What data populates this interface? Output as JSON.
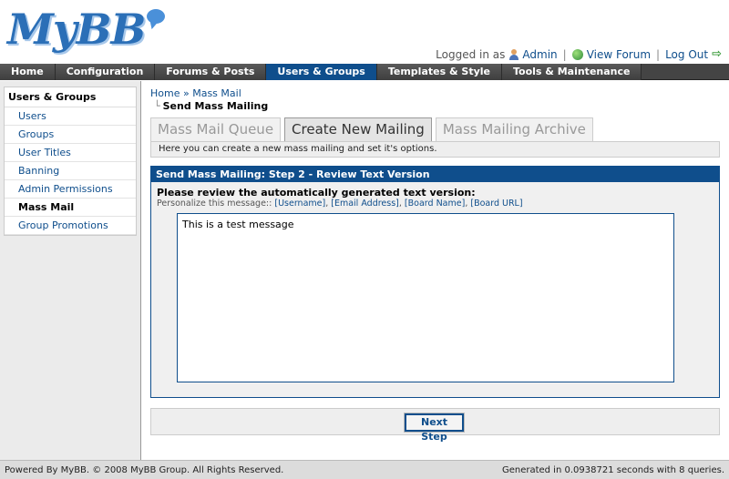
{
  "header": {
    "logo_text": "MyBB",
    "logged_in_label": "Logged in as",
    "username": "Admin",
    "view_forum": "View Forum",
    "log_out": "Log Out",
    "separator": "|"
  },
  "menu": {
    "tabs": [
      {
        "label": "Home"
      },
      {
        "label": "Configuration"
      },
      {
        "label": "Forums & Posts"
      },
      {
        "label": "Users & Groups",
        "active": true
      },
      {
        "label": "Templates & Style"
      },
      {
        "label": "Tools & Maintenance"
      }
    ]
  },
  "sidebar": {
    "title": "Users & Groups",
    "items": [
      {
        "label": "Users"
      },
      {
        "label": "Groups"
      },
      {
        "label": "User Titles"
      },
      {
        "label": "Banning"
      },
      {
        "label": "Admin Permissions"
      },
      {
        "label": "Mass Mail",
        "active": true
      },
      {
        "label": "Group Promotions"
      }
    ]
  },
  "breadcrumb": {
    "home": "Home",
    "sep": "»",
    "parent": "Mass Mail",
    "current": "Send Mass Mailing"
  },
  "subtabs": [
    {
      "label": "Mass Mail Queue"
    },
    {
      "label": "Create New Mailing",
      "active": true
    },
    {
      "label": "Mass Mailing Archive"
    }
  ],
  "tab_description": "Here you can create a new mass mailing and set it's options.",
  "form": {
    "header": "Send Mass Mailing: Step 2 - Review Text Version",
    "label": "Please review the automatically generated text version:",
    "personalize_label": "Personalize this message::",
    "tokens": [
      "[Username]",
      "[Email Address]",
      "[Board Name]",
      "[Board URL]"
    ],
    "message": "This is a test message",
    "next_button": "Next Step"
  },
  "footer": {
    "left": "Powered By MyBB. © 2008 MyBB Group. All Rights Reserved.",
    "right": "Generated in 0.0938721 seconds with 8 queries."
  },
  "colors": {
    "brand_blue": "#0f4e8c",
    "menu_dark": "#444444"
  }
}
